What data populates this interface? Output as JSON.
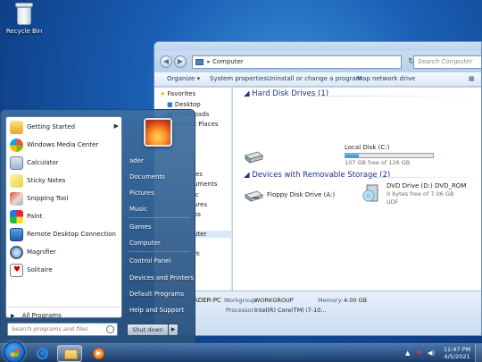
{
  "desktop": {
    "recycle_bin": "Recycle Bin"
  },
  "explorer": {
    "address": "Computer",
    "search_placeholder": "Search Computer",
    "commands": [
      "Organize",
      "System properties",
      "Uninstall or change a program",
      "Map network drive"
    ],
    "nav": {
      "favorites": "Favorites",
      "items": [
        "Desktop",
        "Downloads",
        "Recent Places"
      ],
      "partial": [
        "ies",
        "uments",
        "ic",
        "ures",
        "os",
        "uter",
        "rk"
      ]
    },
    "groups": {
      "hdd": "Hard Disk Drives (1)",
      "removable": "Devices with Removable Storage (2)"
    },
    "drives": {
      "local": {
        "name": "Local Disk (C:)",
        "free": "107 GB free of 126 GB",
        "used_fraction": 0.15
      },
      "floppy": {
        "name": "Floppy Disk Drive (A:)"
      },
      "dvd": {
        "name": "DVD Drive (D:) DVD_ROM",
        "free": "0 bytes free of 7.06 GB",
        "fs": "UDF"
      }
    },
    "details": {
      "pc": "ADER-PC",
      "workgroup_label": "Workgroup:",
      "workgroup": "WORKGROUP",
      "memory_label": "Memory:",
      "memory": "4.00 GB",
      "processor_label": "Processor:",
      "processor": "Intel(R) Core(TM) i7-10..."
    }
  },
  "startmenu": {
    "programs": [
      {
        "label": "Getting Started",
        "icon": "getting-started-icon",
        "arrow": "▶"
      },
      {
        "label": "Windows Media Center",
        "icon": "media-center-icon"
      },
      {
        "label": "Calculator",
        "icon": "calculator-icon"
      },
      {
        "label": "Sticky Notes",
        "icon": "sticky-notes-icon"
      },
      {
        "label": "Snipping Tool",
        "icon": "snipping-tool-icon"
      },
      {
        "label": "Paint",
        "icon": "paint-icon"
      },
      {
        "label": "Remote Desktop Connection",
        "icon": "remote-desktop-icon"
      },
      {
        "label": "Magnifier",
        "icon": "magnifier-icon"
      },
      {
        "label": "Solitaire",
        "icon": "solitaire-icon"
      }
    ],
    "all_programs": "All Programs",
    "search_placeholder": "Search programs and files",
    "right": [
      "ader",
      "Documents",
      "Pictures",
      "Music",
      "Games",
      "Computer",
      "Control Panel",
      "Devices and Printers",
      "Default Programs",
      "Help and Support"
    ],
    "shutdown": "Shut down"
  },
  "taskbar": {
    "time": "11:47 PM",
    "date": "4/5/2021"
  }
}
